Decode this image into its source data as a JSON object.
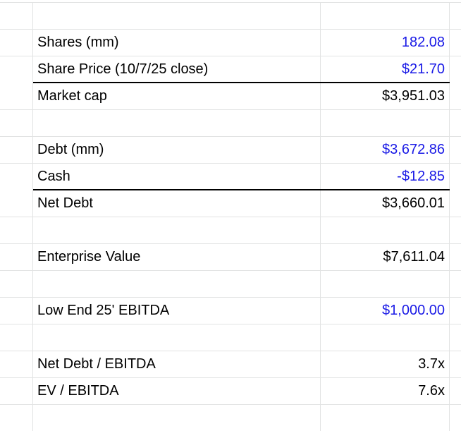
{
  "rows": [
    {
      "label": "",
      "value": ""
    },
    {
      "label": "Shares (mm)",
      "value": "182.08",
      "input": true
    },
    {
      "label": "Share Price (10/7/25 close)",
      "value": "$21.70",
      "input": true
    },
    {
      "label": "Market cap",
      "value": "$3,951.03"
    },
    {
      "label": "",
      "value": ""
    },
    {
      "label": "Debt (mm)",
      "value": "$3,672.86",
      "input": true
    },
    {
      "label": "Cash",
      "value": "-$12.85",
      "input": true
    },
    {
      "label": "Net Debt",
      "value": "$3,660.01"
    },
    {
      "label": "",
      "value": ""
    },
    {
      "label": "Enterprise Value",
      "value": "$7,611.04"
    },
    {
      "label": "",
      "value": ""
    },
    {
      "label": "Low End 25' EBITDA",
      "value": "$1,000.00",
      "input": true
    },
    {
      "label": "",
      "value": ""
    },
    {
      "label": "Net Debt / EBITDA",
      "value": "3.7x"
    },
    {
      "label": "EV / EBITDA",
      "value": "7.6x"
    },
    {
      "label": "",
      "value": ""
    }
  ],
  "colors": {
    "input_text": "#1a1ae6",
    "formula_text": "#000000",
    "gridline": "#e2e3e3",
    "total_border": "#000000"
  }
}
